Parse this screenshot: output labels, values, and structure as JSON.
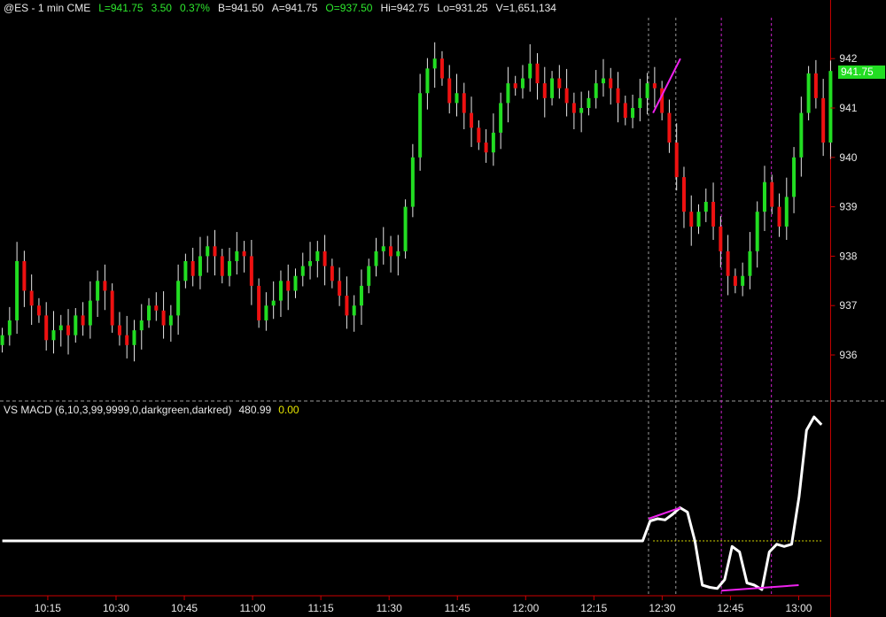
{
  "header": {
    "symbol": "@ES - 1 min  CME",
    "last": "L=941.75",
    "change": "3.50",
    "pct": "0.37%",
    "bid": "B=941.50",
    "ask": "A=941.75",
    "open": "O=937.50",
    "high": "Hi=942.75",
    "low": "Lo=931.25",
    "volume": "V=1,651,134"
  },
  "indicator": {
    "name": "VS  MACD (6,10,3,99,9999,0,darkgreen,darkred)",
    "value": "480.99",
    "zero": "0.00"
  },
  "price_tag": "941.75",
  "colors": {
    "up": "#22dd22",
    "down": "#ee1111",
    "wick": "#e6e6e6",
    "macd": "#ffffff",
    "divergence": "#ee22ee",
    "separator": "#cc0000",
    "zero_line": "#d8d800"
  },
  "chart_data": [
    {
      "type": "candlestick",
      "title": "",
      "y_ticks": [
        "936",
        "937",
        "938",
        "939",
        "940",
        "941",
        "942"
      ],
      "ylim": [
        935.3,
        943.5
      ],
      "x_ticks": [
        "10:15",
        "10:30",
        "10:45",
        "11:00",
        "11:15",
        "11:30",
        "11:45",
        "12:00",
        "12:15",
        "12:30",
        "12:45",
        "13:00"
      ],
      "x_tick_minutes": [
        615,
        630,
        645,
        660,
        675,
        690,
        705,
        720,
        735,
        750,
        765,
        780
      ],
      "xlim": [
        604.5,
        787.5
      ],
      "candles_x_minutes": [
        605,
        787
      ],
      "close_path": [
        936.4,
        936.7,
        937.9,
        937.3,
        937.0,
        936.8,
        936.3,
        936.5,
        936.6,
        936.4,
        936.8,
        936.6,
        937.1,
        937.5,
        937.3,
        936.6,
        936.4,
        936.2,
        936.5,
        936.7,
        937.0,
        936.9,
        936.6,
        936.8,
        937.5,
        937.9,
        937.6,
        938.0,
        938.2,
        938.0,
        937.6,
        937.9,
        938.1,
        938.0,
        937.4,
        936.7,
        937.0,
        937.1,
        937.5,
        937.3,
        937.6,
        937.8,
        937.9,
        938.1,
        937.8,
        937.5,
        937.2,
        936.8,
        937.0,
        937.4,
        937.8,
        938.1,
        938.2,
        938.0,
        938.1,
        939.0,
        940.0,
        941.3,
        941.8,
        942.0,
        941.6,
        941.1,
        941.3,
        940.9,
        940.6,
        940.3,
        940.1,
        940.5,
        941.1,
        941.5,
        941.4,
        941.6,
        941.9,
        941.5,
        941.2,
        941.6,
        941.4,
        941.1,
        940.9,
        941.0,
        941.2,
        941.5,
        941.6,
        941.4,
        941.1,
        940.8,
        941.0,
        941.2,
        941.5,
        941.4,
        940.9,
        940.3,
        939.6,
        938.9,
        938.6,
        938.9,
        939.1,
        938.6,
        938.1,
        937.6,
        937.4,
        937.6,
        938.1,
        938.9,
        939.5,
        939.0,
        938.6,
        939.2,
        940.0,
        940.9,
        941.7,
        941.2,
        940.3,
        941.75
      ],
      "divergence_line_price": [
        {
          "x_minutes": 748,
          "y": 940.9
        },
        {
          "x_minutes": 754,
          "y": 942.0
        }
      ]
    },
    {
      "type": "line",
      "title": "VS  MACD (6,10,3,99,9999,0,darkgreen,darkred)",
      "zero_line_value": 0,
      "series": [
        {
          "values_path": [
            0,
            0,
            0,
            0,
            0,
            0,
            0,
            0,
            0,
            0,
            0,
            0,
            0,
            0,
            0,
            0,
            0,
            0,
            0,
            0,
            0,
            0,
            0,
            0,
            0,
            0,
            0,
            0,
            0,
            0,
            0,
            0,
            0,
            0,
            0,
            0,
            0,
            0,
            0,
            0,
            0,
            0,
            0,
            0,
            0,
            0,
            0,
            0,
            0,
            0,
            0,
            0,
            0,
            0,
            0,
            0,
            0,
            0,
            0,
            0,
            0,
            0,
            0,
            0,
            0,
            0,
            0,
            0,
            0,
            0,
            0,
            0,
            0,
            0,
            0,
            0,
            0,
            0,
            0,
            0,
            0,
            0,
            0,
            0,
            0,
            0,
            0,
            18,
            20,
            19,
            24,
            30,
            26,
            0,
            -40,
            -42,
            -43,
            -35,
            -5,
            -10,
            -38,
            -40,
            -44,
            -10,
            -3,
            -5,
            -3,
            40,
            100,
            112,
            105
          ]
        }
      ],
      "divergence_line_macd": [
        {
          "x_minutes": 747,
          "y": 20
        },
        {
          "x_minutes": 754,
          "y": 30
        },
        {
          "x_minutes": 763,
          "y": -45
        },
        {
          "x_minutes": 780,
          "y": -40
        }
      ]
    }
  ],
  "markers": {
    "vertical_lines_minutes": [
      747,
      753,
      763,
      774
    ],
    "separator_minute": 787
  }
}
